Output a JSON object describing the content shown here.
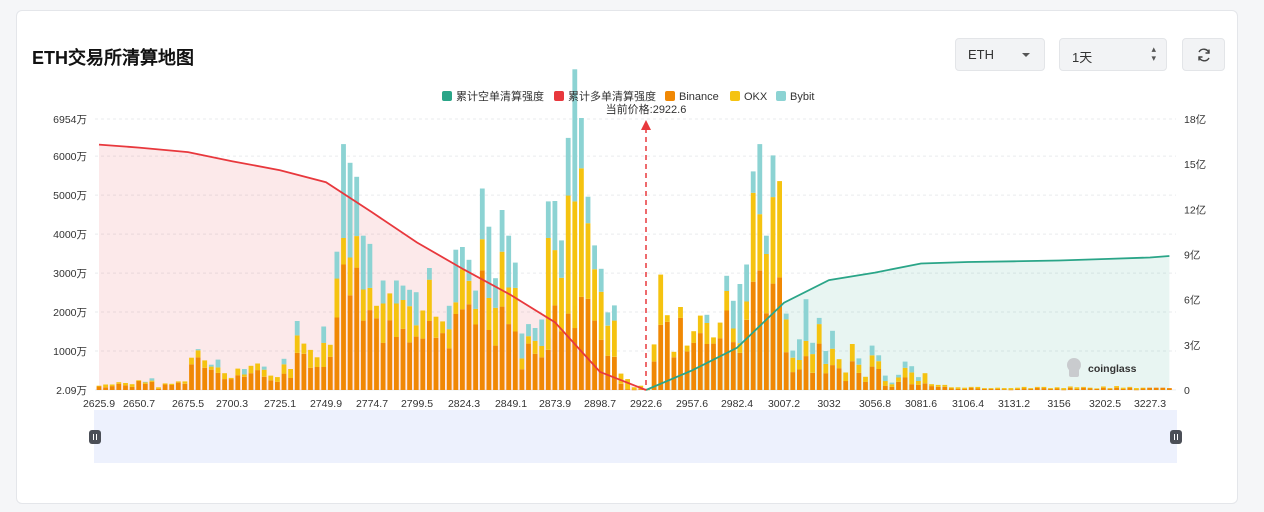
{
  "page": {
    "title": "ETH交易所清算地图",
    "coin_select": "ETH",
    "period_select": "1天",
    "refresh_icon": "refresh-icon"
  },
  "chart_data": {
    "type": "bar",
    "stacked": true,
    "current_price_label": "当前价格:2922.6",
    "current_price": 2922.6,
    "watermark": "coinglass",
    "legend": [
      {
        "name": "累计空单清算强度",
        "color": "#2aa588"
      },
      {
        "name": "累计多单清算强度",
        "color": "#e8383d"
      },
      {
        "name": "Binance",
        "color": "#f08804"
      },
      {
        "name": "OKX",
        "color": "#f5c310"
      },
      {
        "name": "Bybit",
        "color": "#8cd3d3"
      }
    ],
    "y_left_ticks": [
      "2.09万",
      "1000万",
      "2000万",
      "3000万",
      "4000万",
      "5000万",
      "6000万",
      "6954万"
    ],
    "y_left_values": [
      2.09,
      1000,
      2000,
      3000,
      4000,
      5000,
      6000,
      6954
    ],
    "y_left_unit": "万",
    "y_right_ticks": [
      "0",
      "3亿",
      "6亿",
      "9亿",
      "12亿",
      "15亿",
      "18亿"
    ],
    "y_right_values": [
      0,
      3,
      6,
      9,
      12,
      15,
      18
    ],
    "y_right_unit": "亿",
    "x_ticks": [
      "2625.9",
      "2650.7",
      "2675.5",
      "2700.3",
      "2725.1",
      "2749.9",
      "2774.7",
      "2799.5",
      "2824.3",
      "2849.1",
      "2873.9",
      "2898.7",
      "2922.6",
      "2957.6",
      "2982.4",
      "3007.2",
      "3032",
      "3056.8",
      "3081.6",
      "3106.4",
      "3131.2",
      "3156",
      "3202.5",
      "3227.3"
    ],
    "categories_range": [
      "2625.9",
      "3238.0"
    ],
    "series": [
      {
        "name": "Binance",
        "values": [
          90,
          70,
          100,
          160,
          120,
          80,
          230,
          160,
          210,
          30,
          140,
          130,
          190,
          160,
          660,
          840,
          570,
          520,
          440,
          280,
          280,
          380,
          340,
          430,
          510,
          340,
          250,
          210,
          420,
          310,
          950,
          930,
          570,
          590,
          590,
          850,
          1860,
          3220,
          2430,
          3140,
          1780,
          2050,
          1840,
          1210,
          1790,
          1360,
          1570,
          1220,
          1370,
          1320,
          1770,
          1340,
          1460,
          1070,
          1950,
          2070,
          2200,
          1680,
          3070,
          1540,
          1140,
          2140,
          1690,
          1500,
          530,
          1190,
          930,
          840,
          1030,
          2170,
          1500,
          1960,
          1590,
          2390,
          2340,
          1780,
          1290,
          880,
          850,
          160,
          20,
          10,
          20,
          10,
          730,
          1670,
          1750,
          840,
          1850,
          990,
          1210,
          1460,
          1180,
          1190,
          1330,
          2040,
          1230,
          950,
          1800,
          2780,
          3070,
          1970,
          2730,
          2890,
          970,
          460,
          530,
          870,
          440,
          1190,
          430,
          640,
          560,
          230,
          740,
          440,
          210,
          600,
          540,
          110,
          80,
          210,
          320,
          150,
          130,
          170,
          100,
          80,
          80,
          40,
          30,
          30,
          60,
          40,
          30,
          30,
          30,
          20,
          10,
          30,
          40,
          30,
          60,
          50,
          30,
          40,
          10,
          60,
          30,
          60,
          40,
          30,
          60,
          30,
          60,
          30,
          60,
          10,
          40,
          60,
          60,
          60,
          50
        ]
      },
      {
        "name": "OKX",
        "values": [
          20,
          70,
          40,
          40,
          60,
          70,
          20,
          40,
          30,
          40,
          30,
          30,
          30,
          60,
          170,
          180,
          190,
          80,
          140,
          150,
          30,
          170,
          60,
          190,
          170,
          180,
          120,
          120,
          240,
          230,
          450,
          260,
          460,
          250,
          620,
          310,
          1000,
          680,
          970,
          810,
          800,
          570,
          320,
          1010,
          690,
          860,
          740,
          930,
          290,
          720,
          1060,
          540,
          300,
          490,
          300,
          1030,
          600,
          400,
          800,
          820,
          970,
          1410,
          940,
          1120,
          280,
          190,
          330,
          290,
          2870,
          1420,
          1380,
          3030,
          3250,
          3300,
          1940,
          1320,
          1230,
          770,
          930,
          260,
          260,
          60,
          90,
          20,
          440,
          1290,
          170,
          140,
          280,
          150,
          300,
          450,
          540,
          160,
          400,
          500,
          350,
          250,
          470,
          2280,
          1440,
          1520,
          2220,
          2470,
          840,
          370,
          240,
          390,
          480,
          500,
          240,
          420,
          230,
          220,
          440,
          210,
          130,
          290,
          200,
          120,
          70,
          110,
          250,
          300,
          100,
          260,
          50,
          50,
          50,
          30,
          40,
          30,
          20,
          40,
          20,
          20,
          30,
          30,
          40,
          30,
          40,
          20,
          20,
          30,
          20,
          30,
          40,
          30,
          40,
          20,
          20,
          10,
          30,
          20,
          40,
          30,
          20,
          40,
          20
        ]
      },
      {
        "name": "Bybit",
        "values": [
          0,
          0,
          0,
          0,
          0,
          0,
          0,
          10,
          60,
          0,
          0,
          0,
          0,
          0,
          0,
          30,
          0,
          50,
          200,
          0,
          0,
          0,
          140,
          0,
          0,
          80,
          0,
          0,
          140,
          0,
          370,
          0,
          0,
          0,
          420,
          0,
          690,
          2410,
          2430,
          1520,
          1380,
          1130,
          0,
          590,
          0,
          590,
          370,
          420,
          850,
          0,
          300,
          0,
          0,
          600,
          1350,
          570,
          540,
          470,
          1300,
          1830,
          760,
          1070,
          1330,
          650,
          640,
          310,
          330,
          680,
          940,
          1260,
          960,
          1480,
          3390,
          1290,
          680,
          610,
          590,
          340,
          390,
          0,
          0,
          0,
          0,
          0,
          0,
          0,
          0,
          0,
          0,
          0,
          0,
          0,
          210,
          0,
          0,
          390,
          710,
          1520,
          950,
          550,
          1800,
          470,
          1070,
          0,
          150,
          180,
          530,
          1070,
          290,
          160,
          330,
          460,
          0,
          0,
          0,
          160,
          0,
          250,
          150,
          140,
          40,
          70,
          160,
          160,
          100,
          0,
          0,
          0,
          0,
          0,
          0,
          0,
          0,
          0,
          0,
          0,
          0,
          0,
          0,
          0,
          0,
          0,
          0,
          0,
          0,
          0,
          0,
          0,
          0,
          0,
          0,
          0,
          0,
          0,
          0,
          0,
          0,
          0,
          0,
          0
        ]
      },
      {
        "name": "累计多单清算强度",
        "axis": "right",
        "x": [
          "2625.9",
          "2650.7",
          "2675.5",
          "2700.3",
          "2725.1",
          "2749.9",
          "2774.7",
          "2799.5",
          "2824.3",
          "2849.1",
          "2873.9",
          "2898.7",
          "2922.6"
        ],
        "values": [
          16.3,
          16.1,
          15.8,
          15.2,
          14.6,
          13.8,
          11.8,
          9.8,
          8.0,
          6.3,
          4.5,
          1.2,
          0
        ]
      },
      {
        "name": "累计空单清算强度",
        "axis": "right",
        "x": [
          "2922.6",
          "2957.6",
          "2982.4",
          "3007.2",
          "3032",
          "3056.8",
          "3081.6",
          "3106.4",
          "3131.2",
          "3156",
          "3202.5",
          "3227.3",
          "3238.0"
        ],
        "values": [
          0,
          1.3,
          2.8,
          5.8,
          7.3,
          7.8,
          8.4,
          8.5,
          8.55,
          8.6,
          8.7,
          8.8,
          8.9
        ]
      }
    ],
    "grid": true,
    "legend_position": "top-center"
  }
}
